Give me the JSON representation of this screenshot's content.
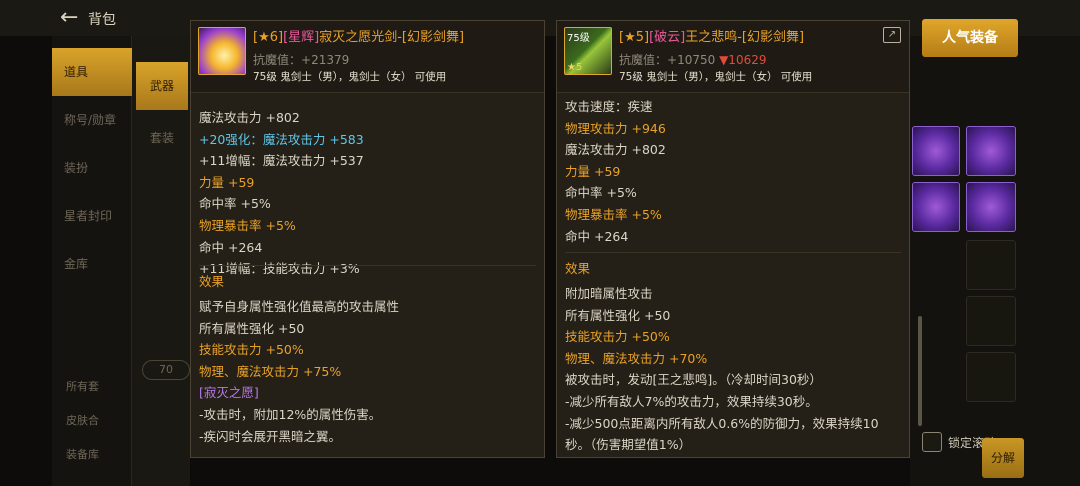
{
  "background": {
    "title": "背包",
    "side_menu": [
      "道具",
      "称号/勋章",
      "装扮",
      "星者封印",
      "金库"
    ],
    "sub_menu": [
      "武器",
      "套装"
    ],
    "count_badge": "70",
    "bottom_rows": [
      "所有套",
      "皮肤合",
      "装备库"
    ],
    "hot_button": "人气装备",
    "lock_scroll": "锁定滚动",
    "split_button": "分解"
  },
  "left_item": {
    "grade": "[★6]",
    "tag": "[星辉]",
    "name": "寂灭之愿光剑-[幻影剑舞]",
    "power_label": "抗魔值：",
    "power_delta": "+21379",
    "usable": "75级 鬼剑士（男），鬼剑士（女） 可使用",
    "stats": [
      {
        "text": "魔法攻击力 +802",
        "color": "white"
      },
      {
        "text": "+20强化：魔法攻击力 +583",
        "color": "cyan"
      },
      {
        "text": " +11增幅：魔法攻击力 +537",
        "color": "white"
      },
      {
        "text": "力量 +59",
        "color": "orange"
      },
      {
        "text": "命中率 +5%",
        "color": "white"
      },
      {
        "text": "物理暴击率 +5%",
        "color": "orange"
      },
      {
        "text": "命中 +264",
        "color": "white"
      },
      {
        "text": " +11增幅：技能攻击力 +3%",
        "color": "white"
      }
    ],
    "effect_title": "效果",
    "effects": [
      {
        "text": "赋予自身属性强化值最高的攻击属性",
        "color": "white"
      },
      {
        "text": "所有属性强化 +50",
        "color": "white"
      },
      {
        "text": "技能攻击力 +50%",
        "color": "orange"
      },
      {
        "text": "物理、魔法攻击力 +75%",
        "color": "orange"
      },
      {
        "text": "[寂灭之愿]",
        "color": "purple"
      },
      {
        "text": "-攻击时，附加12%的属性伤害。",
        "color": "white"
      },
      {
        "text": "-疾闪时会展开黑暗之翼。",
        "color": "white"
      }
    ]
  },
  "right_item": {
    "icon_level": "75级",
    "icon_star": "★5",
    "grade": "[★5]",
    "tag": "[破云]",
    "name": "王之悲鸣-[幻影剑舞]",
    "power_label": "抗魔值：",
    "power_delta": "+10750",
    "power_down": "▼10629",
    "usable": "75级 鬼剑士（男），鬼剑士（女） 可使用",
    "stats": [
      {
        "text": "攻击速度：疾速",
        "color": "white"
      },
      {
        "text": "物理攻击力 +946",
        "color": "orange"
      },
      {
        "text": "魔法攻击力 +802",
        "color": "white"
      },
      {
        "text": "力量 +59",
        "color": "orange"
      },
      {
        "text": "命中率 +5%",
        "color": "white"
      },
      {
        "text": "物理暴击率 +5%",
        "color": "orange"
      },
      {
        "text": "命中 +264",
        "color": "white"
      }
    ],
    "effect_title": "效果",
    "effects": [
      {
        "text": "附加暗属性攻击",
        "color": "white"
      },
      {
        "text": "所有属性强化 +50",
        "color": "white"
      },
      {
        "text": "技能攻击力 +50%",
        "color": "orange"
      },
      {
        "text": "物理、魔法攻击力 +70%",
        "color": "orange"
      },
      {
        "text": "被攻击时，发动[王之悲鸣]。（冷却时间30秒）",
        "color": "white"
      },
      {
        "text": "-减少所有敌人7%的攻击力，效果持续30秒。",
        "color": "white"
      },
      {
        "text": "-减少500点距离内所有敌人0.6%的防御力，效果持续10",
        "color": "white"
      },
      {
        "text": "秒。（伤害期望值1%）",
        "color": "white"
      }
    ]
  }
}
